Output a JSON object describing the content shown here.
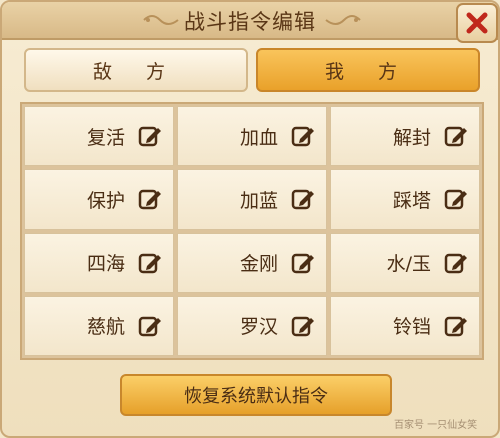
{
  "dialog": {
    "title": "战斗指令编辑",
    "close_label": "✕"
  },
  "tabs": [
    {
      "label": "敌 方",
      "active": false
    },
    {
      "label": "我 方",
      "active": true
    }
  ],
  "commands": [
    {
      "label": "复活"
    },
    {
      "label": "加血"
    },
    {
      "label": "解封"
    },
    {
      "label": "保护"
    },
    {
      "label": "加蓝"
    },
    {
      "label": "踩塔"
    },
    {
      "label": "四海"
    },
    {
      "label": "金刚"
    },
    {
      "label": "水/玉"
    },
    {
      "label": "慈航"
    },
    {
      "label": "罗汉"
    },
    {
      "label": "铃铛"
    }
  ],
  "reset_button": {
    "label": "恢复系统默认指令"
  },
  "watermark": "百家号 一只仙女笑",
  "colors": {
    "accent": "#f0a532",
    "text": "#4a2d14",
    "close_x": "#c0281c"
  }
}
